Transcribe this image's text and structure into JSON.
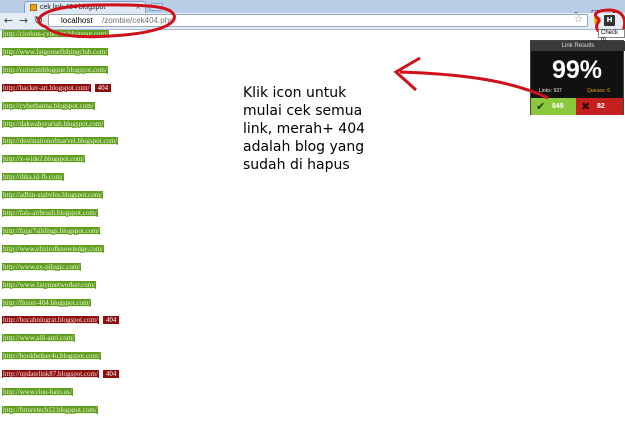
{
  "browser": {
    "tab_title": "cek link 404 blogspot",
    "tab_close": "×",
    "window_controls": [
      "–",
      "□",
      "×"
    ],
    "nav": {
      "back": "←",
      "forward": "→",
      "reload": "↻"
    },
    "url_host": "localhost",
    "url_path": "/zombie/cek404.php",
    "bookmark_star": "☆",
    "ext_h_label": "H",
    "ext_tooltip": "Check m"
  },
  "links": [
    {
      "url": "http://cirebon-cyber4rt.blogspot.com/",
      "status": "ok",
      "code": ""
    },
    {
      "url": "http://www.fatgooseflshingclub.com/",
      "status": "ok",
      "code": ""
    },
    {
      "url": "http://corotamblogque.blogspot.com/",
      "status": "ok",
      "code": ""
    },
    {
      "url": "http://hacker-art.blogspot.com/",
      "status": "404",
      "code": "404"
    },
    {
      "url": "http://cyberbanna.blogspot.com/",
      "status": "ok",
      "code": ""
    },
    {
      "url": "http://dakwahsyariah.blogspot.com/",
      "status": "ok",
      "code": ""
    },
    {
      "url": "http://destinationofmarvel.blogspot.com/",
      "status": "ok",
      "code": ""
    },
    {
      "url": "http://x-wide2.blogspot.com/",
      "status": "ok",
      "code": ""
    },
    {
      "url": "http://dika.id-fb.com/",
      "status": "ok",
      "code": ""
    },
    {
      "url": "http://adhin-stabylos.blogspot.com/",
      "status": "ok",
      "code": ""
    },
    {
      "url": "http://fals-airbrush.blogspot.com/",
      "status": "ok",
      "code": ""
    },
    {
      "url": "http://fajar7siblings.blogspot.com/",
      "status": "ok",
      "code": ""
    },
    {
      "url": "http://www.elixirofknowledge.com/",
      "status": "ok",
      "code": ""
    },
    {
      "url": "http://www.ex-pilogic.com/",
      "status": "ok",
      "code": ""
    },
    {
      "url": "http://www.1stynnetworker.com/",
      "status": "ok",
      "code": ""
    },
    {
      "url": "http://flozer-404.blogspot.com/",
      "status": "ok",
      "code": ""
    },
    {
      "url": "http://bocahningrat.blogspot.com/",
      "status": "404",
      "code": "404"
    },
    {
      "url": "http://www.alil-anri.com/",
      "status": "ok",
      "code": ""
    },
    {
      "url": "http://bookhelper4u.blogspot.com/",
      "status": "ok",
      "code": ""
    },
    {
      "url": "http://updatelink87.blogspot.com/",
      "status": "404",
      "code": "404"
    },
    {
      "url": "http://www.riou-hato.us/",
      "status": "ok",
      "code": ""
    },
    {
      "url": "http://futuretech12.blogspot.com/",
      "status": "ok",
      "code": ""
    }
  ],
  "popup": {
    "title": "Link Results",
    "percent": "99%",
    "links_label": "Links: 937",
    "queue_label": "Queues: 6",
    "pass_icon": "✔",
    "pass_count": "849",
    "fail_icon": "✖",
    "fail_count": "82"
  },
  "note": {
    "lines": [
      "Klik icon untuk",
      "mulai cek semua",
      "link, merah+ 404",
      "adalah blog yang",
      "sudah di hapus"
    ]
  },
  "colors": {
    "ok_bg": "#5f9e1e",
    "bad_bg": "#8e0e0e",
    "annotation": "#d0101a",
    "pass": "#8cc83c",
    "fail": "#c42020",
    "queue_text": "#e5a01c"
  }
}
